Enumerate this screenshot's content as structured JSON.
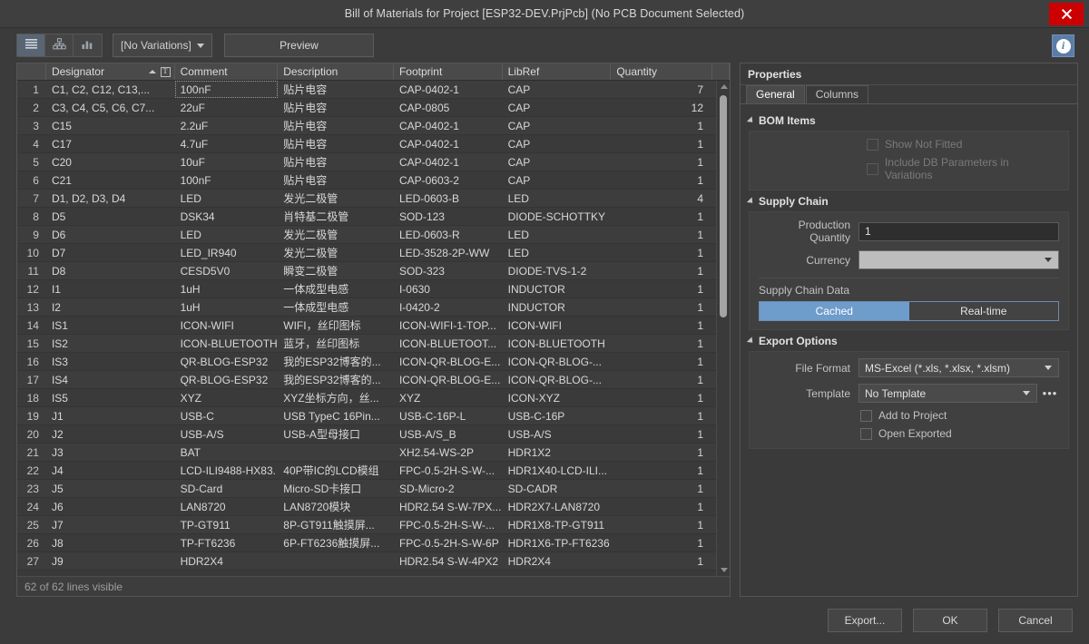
{
  "window": {
    "title": "Bill of Materials for Project [ESP32-DEV.PrjPcb] (No PCB Document Selected)",
    "close_label": "close-window"
  },
  "toolbar": {
    "view_buttons": [
      {
        "name": "flat-list-view",
        "icon": "list-icon"
      },
      {
        "name": "grouped-view",
        "icon": "hierarchy-icon"
      },
      {
        "name": "chart-view",
        "icon": "bar-chart-icon"
      }
    ],
    "variations_value": "[No Variations]",
    "preview_label": "Preview",
    "info_label": "i"
  },
  "grid": {
    "columns": [
      {
        "key": "rownum",
        "label": "",
        "width": "w-rownum"
      },
      {
        "key": "designator",
        "label": "Designator",
        "width": "w-desig",
        "sorted": true,
        "filter": "T"
      },
      {
        "key": "comment",
        "label": "Comment",
        "width": "w-comment"
      },
      {
        "key": "description",
        "label": "Description",
        "width": "w-desc"
      },
      {
        "key": "footprint",
        "label": "Footprint",
        "width": "w-foot"
      },
      {
        "key": "libref",
        "label": "LibRef",
        "width": "w-lib"
      },
      {
        "key": "quantity",
        "label": "Quantity",
        "width": "w-qty"
      },
      {
        "key": "spacer",
        "label": "",
        "width": "w-last"
      }
    ],
    "rows": [
      {
        "n": "1",
        "designator": "C1, C2, C12, C13,...",
        "comment": "100nF",
        "description": "贴片电容",
        "footprint": "CAP-0402-1",
        "libref": "CAP",
        "quantity": "7"
      },
      {
        "n": "2",
        "designator": "C3, C4, C5, C6, C7...",
        "comment": "22uF",
        "description": "贴片电容",
        "footprint": "CAP-0805",
        "libref": "CAP",
        "quantity": "12"
      },
      {
        "n": "3",
        "designator": "C15",
        "comment": "2.2uF",
        "description": "贴片电容",
        "footprint": "CAP-0402-1",
        "libref": "CAP",
        "quantity": "1"
      },
      {
        "n": "4",
        "designator": "C17",
        "comment": "4.7uF",
        "description": "贴片电容",
        "footprint": "CAP-0402-1",
        "libref": "CAP",
        "quantity": "1"
      },
      {
        "n": "5",
        "designator": "C20",
        "comment": "10uF",
        "description": "贴片电容",
        "footprint": "CAP-0402-1",
        "libref": "CAP",
        "quantity": "1"
      },
      {
        "n": "6",
        "designator": "C21",
        "comment": "100nF",
        "description": "贴片电容",
        "footprint": "CAP-0603-2",
        "libref": "CAP",
        "quantity": "1"
      },
      {
        "n": "7",
        "designator": "D1, D2, D3, D4",
        "comment": "LED",
        "description": "发光二极管",
        "footprint": "LED-0603-B",
        "libref": "LED",
        "quantity": "4"
      },
      {
        "n": "8",
        "designator": "D5",
        "comment": "DSK34",
        "description": "肖特基二极管",
        "footprint": "SOD-123",
        "libref": "DIODE-SCHOTTKY",
        "quantity": "1"
      },
      {
        "n": "9",
        "designator": "D6",
        "comment": "LED",
        "description": "发光二极管",
        "footprint": "LED-0603-R",
        "libref": "LED",
        "quantity": "1"
      },
      {
        "n": "10",
        "designator": "D7",
        "comment": "LED_IR940",
        "description": "发光二极管",
        "footprint": "LED-3528-2P-WW",
        "libref": "LED",
        "quantity": "1"
      },
      {
        "n": "11",
        "designator": "D8",
        "comment": "CESD5V0",
        "description": "瞬变二极管",
        "footprint": "SOD-323",
        "libref": "DIODE-TVS-1-2",
        "quantity": "1"
      },
      {
        "n": "12",
        "designator": "I1",
        "comment": "1uH",
        "description": "一体成型电感",
        "footprint": "I-0630",
        "libref": "INDUCTOR",
        "quantity": "1"
      },
      {
        "n": "13",
        "designator": "I2",
        "comment": "1uH",
        "description": "一体成型电感",
        "footprint": "I-0420-2",
        "libref": "INDUCTOR",
        "quantity": "1"
      },
      {
        "n": "14",
        "designator": "IS1",
        "comment": "ICON-WIFI",
        "description": "WIFI，丝印图标",
        "footprint": "ICON-WIFI-1-TOP...",
        "libref": "ICON-WIFI",
        "quantity": "1"
      },
      {
        "n": "15",
        "designator": "IS2",
        "comment": "ICON-BLUETOOTH",
        "description": "蓝牙，丝印图标",
        "footprint": "ICON-BLUETOOT...",
        "libref": "ICON-BLUETOOTH",
        "quantity": "1"
      },
      {
        "n": "16",
        "designator": "IS3",
        "comment": "QR-BLOG-ESP32",
        "description": "我的ESP32博客的...",
        "footprint": "ICON-QR-BLOG-E...",
        "libref": "ICON-QR-BLOG-...",
        "quantity": "1"
      },
      {
        "n": "17",
        "designator": "IS4",
        "comment": "QR-BLOG-ESP32",
        "description": "我的ESP32博客的...",
        "footprint": "ICON-QR-BLOG-E...",
        "libref": "ICON-QR-BLOG-...",
        "quantity": "1"
      },
      {
        "n": "18",
        "designator": "IS5",
        "comment": "XYZ",
        "description": "XYZ坐标方向，丝...",
        "footprint": "XYZ",
        "libref": "ICON-XYZ",
        "quantity": "1"
      },
      {
        "n": "19",
        "designator": "J1",
        "comment": "USB-C",
        "description": "USB TypeC 16Pin...",
        "footprint": "USB-C-16P-L",
        "libref": "USB-C-16P",
        "quantity": "1"
      },
      {
        "n": "20",
        "designator": "J2",
        "comment": "USB-A/S",
        "description": "USB-A型母接口",
        "footprint": "USB-A/S_B",
        "libref": "USB-A/S",
        "quantity": "1"
      },
      {
        "n": "21",
        "designator": "J3",
        "comment": "BAT",
        "description": "",
        "footprint": "XH2.54-WS-2P",
        "libref": "HDR1X2",
        "quantity": "1"
      },
      {
        "n": "22",
        "designator": "J4",
        "comment": "LCD-ILI9488-HX83...",
        "description": "40P带IC的LCD模组",
        "footprint": "FPC-0.5-2H-S-W-...",
        "libref": "HDR1X40-LCD-ILI...",
        "quantity": "1"
      },
      {
        "n": "23",
        "designator": "J5",
        "comment": "SD-Card",
        "description": "Micro-SD卡接口",
        "footprint": "SD-Micro-2",
        "libref": "SD-CADR",
        "quantity": "1"
      },
      {
        "n": "24",
        "designator": "J6",
        "comment": "LAN8720",
        "description": "LAN8720模块",
        "footprint": "HDR2.54 S-W-7PX...",
        "libref": "HDR2X7-LAN8720",
        "quantity": "1"
      },
      {
        "n": "25",
        "designator": "J7",
        "comment": "TP-GT911",
        "description": "8P-GT911触摸屏...",
        "footprint": "FPC-0.5-2H-S-W-...",
        "libref": "HDR1X8-TP-GT911",
        "quantity": "1"
      },
      {
        "n": "26",
        "designator": "J8",
        "comment": "TP-FT6236",
        "description": "6P-FT6236触摸屏...",
        "footprint": "FPC-0.5-2H-S-W-6P",
        "libref": "HDR1X6-TP-FT6236",
        "quantity": "1"
      },
      {
        "n": "27",
        "designator": "J9",
        "comment": "HDR2X4",
        "description": "",
        "footprint": "HDR2.54 S-W-4PX2",
        "libref": "HDR2X4",
        "quantity": "1"
      }
    ],
    "status": "62 of 62 lines visible"
  },
  "properties": {
    "title": "Properties",
    "tabs": [
      {
        "label": "General",
        "active": true
      },
      {
        "label": "Columns",
        "active": false
      }
    ],
    "bom_items": {
      "heading": "BOM Items",
      "show_not_fitted": "Show Not Fitted",
      "include_db_params": "Include DB Parameters in Variations"
    },
    "supply_chain": {
      "heading": "Supply Chain",
      "production_quantity_label": "Production Quantity",
      "production_quantity_value": "1",
      "currency_label": "Currency",
      "currency_value": "",
      "supply_chain_data_label": "Supply Chain Data",
      "toggle_cached": "Cached",
      "toggle_realtime": "Real-time",
      "accent": "#6e9ccb"
    },
    "export_options": {
      "heading": "Export Options",
      "file_format_label": "File Format",
      "file_format_value": "MS-Excel (*.xls, *.xlsx, *.xlsm)",
      "template_label": "Template",
      "template_value": "No Template",
      "template_browse": "•••",
      "add_to_project": "Add to Project",
      "open_exported": "Open Exported"
    }
  },
  "footer": {
    "export_label": "Export...",
    "ok_label": "OK",
    "cancel_label": "Cancel"
  }
}
